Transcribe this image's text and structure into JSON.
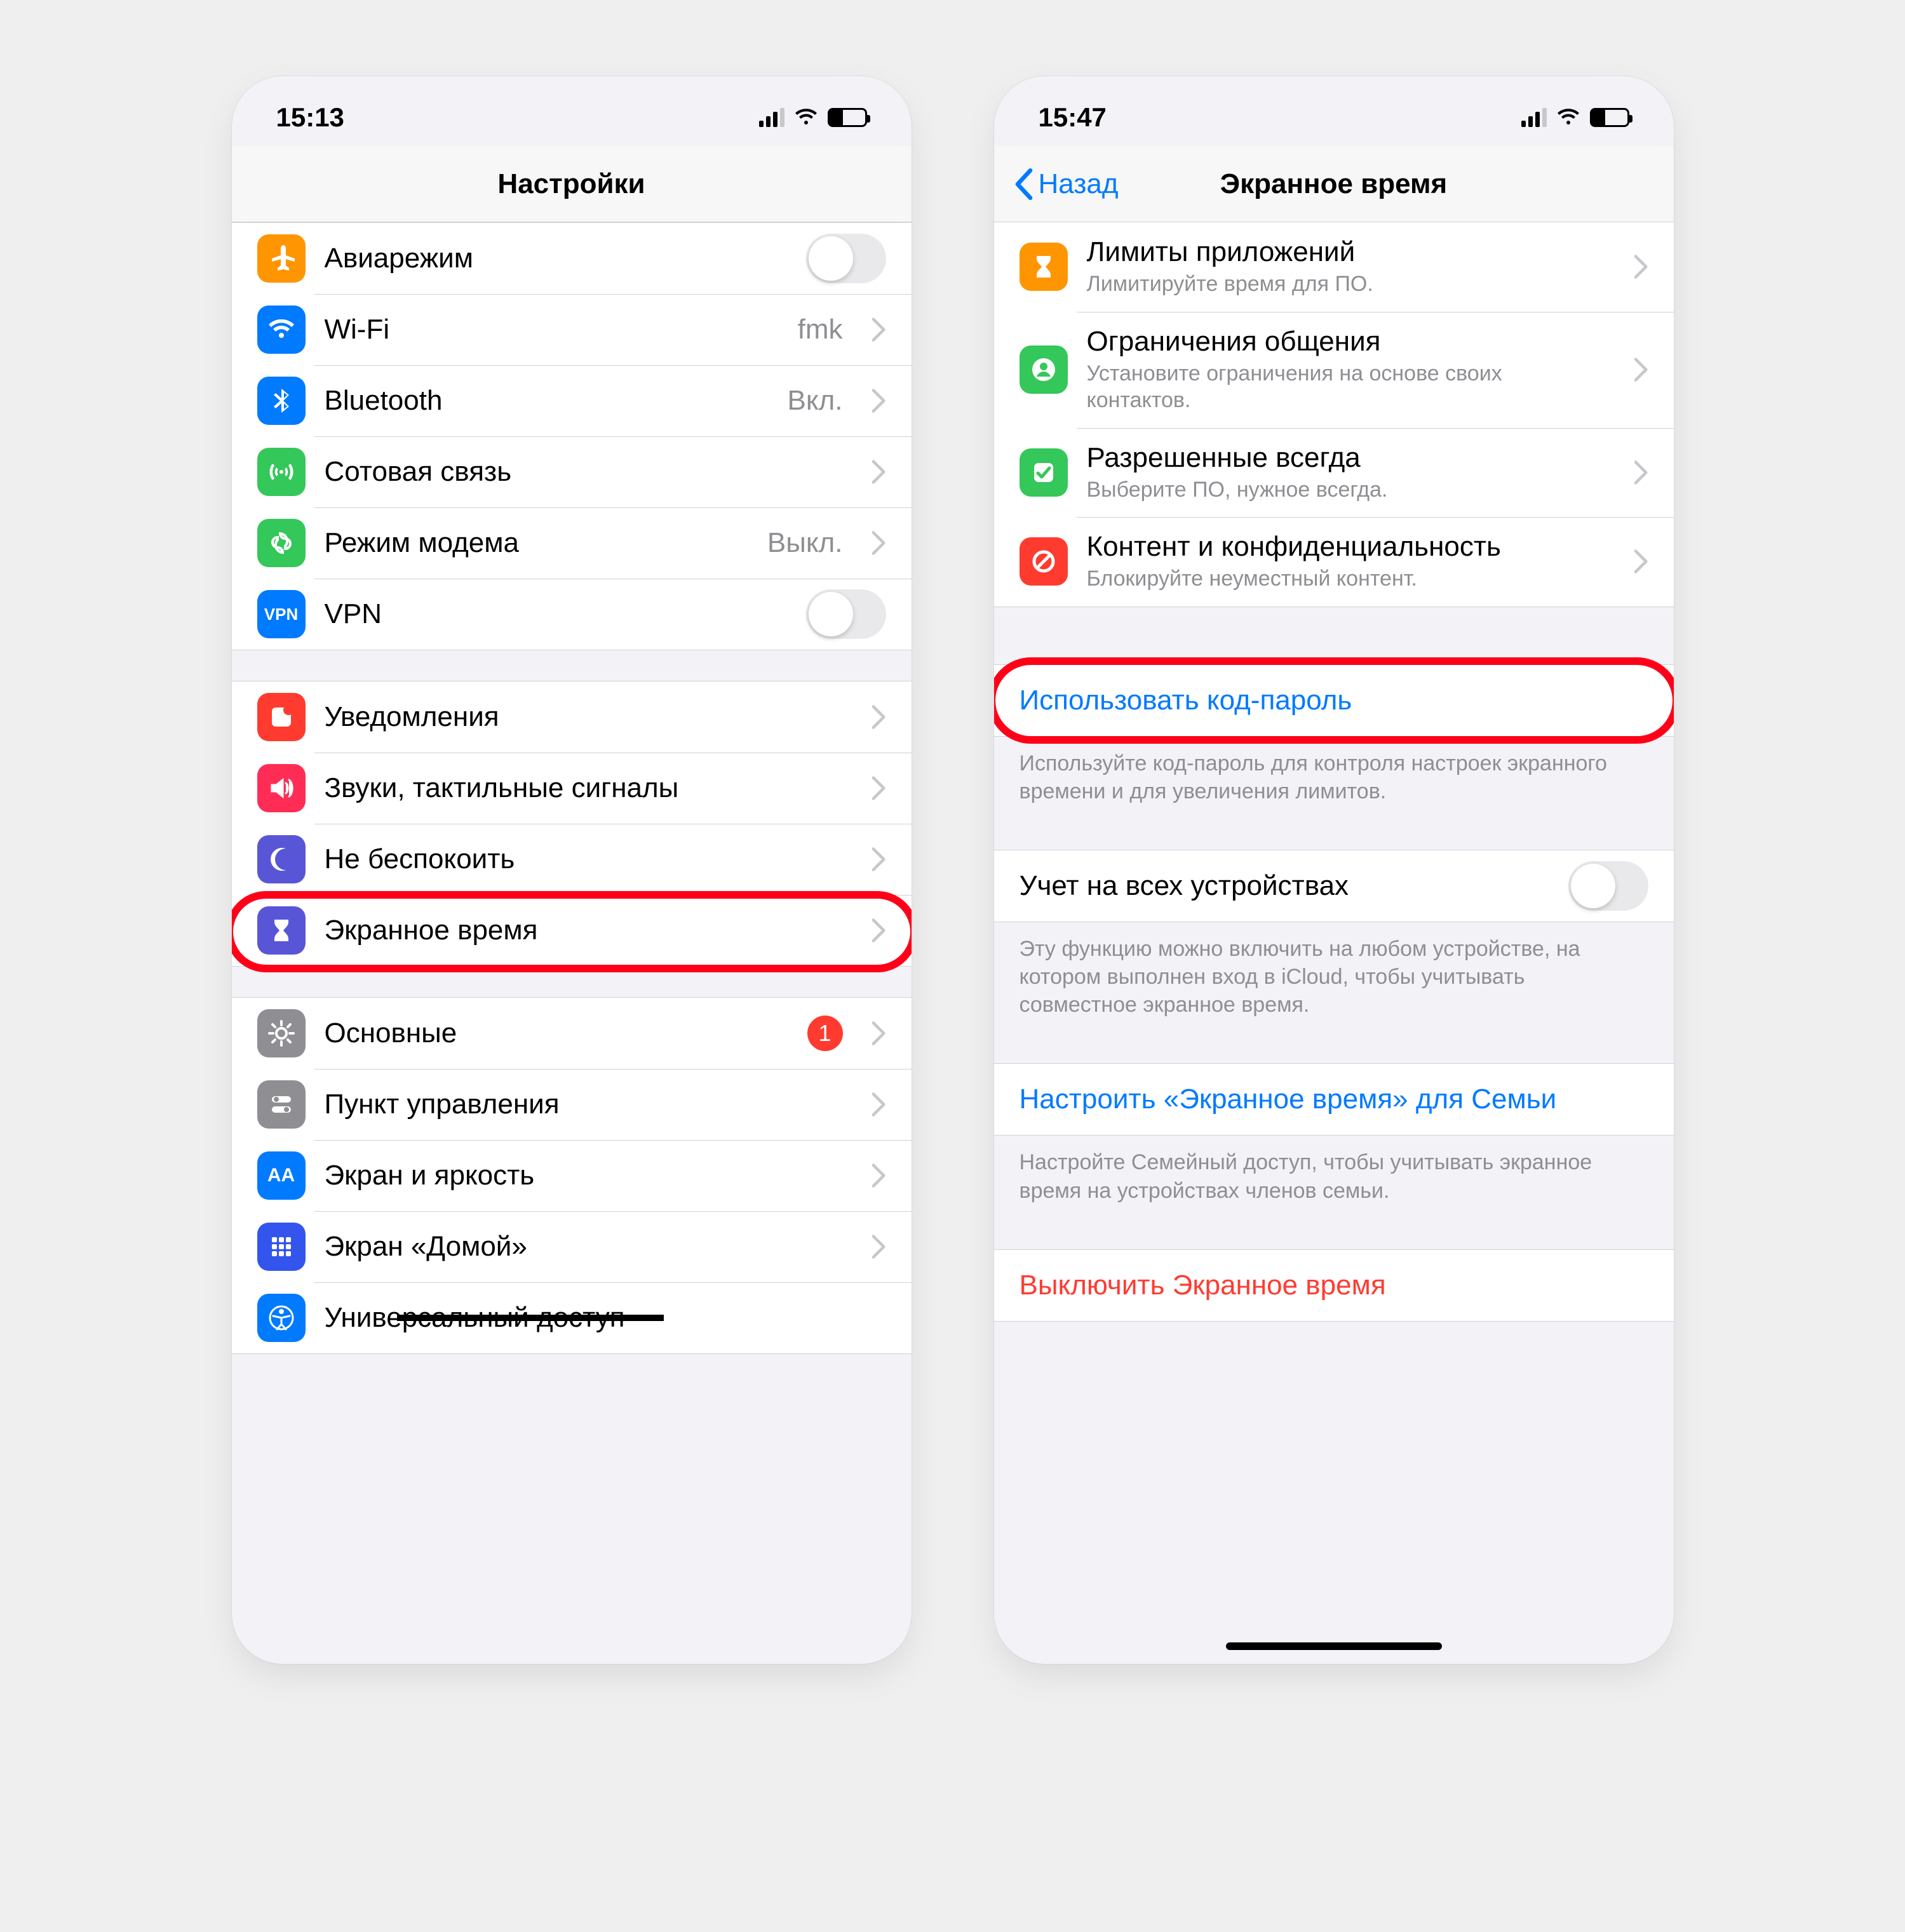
{
  "left": {
    "status_time": "15:13",
    "title": "Настройки",
    "g1": [
      {
        "icon": "airplane",
        "color": "#ff9500",
        "label": "Авиарежим",
        "toggle": true
      },
      {
        "icon": "wifi",
        "color": "#007aff",
        "label": "Wi-Fi",
        "value": "fmk",
        "chev": true
      },
      {
        "icon": "bluetooth",
        "color": "#007aff",
        "label": "Bluetooth",
        "value": "Вкл.",
        "chev": true
      },
      {
        "icon": "cellular",
        "color": "#34c759",
        "label": "Сотовая связь",
        "chev": true
      },
      {
        "icon": "hotspot",
        "color": "#34c759",
        "label": "Режим модема",
        "value": "Выкл.",
        "chev": true
      },
      {
        "icon": "vpn",
        "color": "#007aff",
        "label": "VPN",
        "toggle": true
      }
    ],
    "g2": [
      {
        "icon": "notifications",
        "color": "#ff3b30",
        "label": "Уведомления",
        "chev": true
      },
      {
        "icon": "sounds",
        "color": "#ff2d55",
        "label": "Звуки, тактильные сигналы",
        "chev": true
      },
      {
        "icon": "dnd",
        "color": "#5856d6",
        "label": "Не беспокоить",
        "chev": true
      },
      {
        "icon": "screentime",
        "color": "#5856d6",
        "label": "Экранное время",
        "chev": true,
        "highlight": true
      }
    ],
    "g3": [
      {
        "icon": "general",
        "color": "#8e8e93",
        "label": "Основные",
        "badge": "1",
        "chev": true
      },
      {
        "icon": "control",
        "color": "#8e8e93",
        "label": "Пункт управления",
        "chev": true
      },
      {
        "icon": "display",
        "color": "#007aff",
        "label": "Экран и яркость",
        "chev": true
      },
      {
        "icon": "home",
        "color": "#3355ee",
        "label": "Экран «Домой»",
        "chev": true
      },
      {
        "icon": "accessibility",
        "color": "#007aff",
        "label": "Универсальный доступ",
        "strike": true
      }
    ]
  },
  "right": {
    "status_time": "15:47",
    "back_label": "Назад",
    "title": "Экранное время",
    "g1": [
      {
        "icon": "hourglass",
        "color": "#ff9500",
        "label": "Лимиты приложений",
        "sub": "Лимитируйте время для ПО.",
        "chev": true
      },
      {
        "icon": "contact",
        "color": "#34c759",
        "label": "Ограничения общения",
        "sub": "Установите ограничения на основе своих контактов.",
        "chev": true
      },
      {
        "icon": "allowed",
        "color": "#34c759",
        "label": "Разрешенные всегда",
        "sub": "Выберите ПО, нужное всегда.",
        "chev": true
      },
      {
        "icon": "block",
        "color": "#ff3b30",
        "label": "Контент и конфиденциальность",
        "sub": "Блокируйте неуместный контент.",
        "chev": true
      }
    ],
    "passcode": {
      "label": "Использовать код-пароль",
      "footer": "Используйте код-пароль для контроля настроек экранного времени и для увеличения лимитов."
    },
    "share": {
      "label": "Учет на всех устройствах",
      "footer": "Эту функцию можно включить на любом устройстве, на котором выполнен вход в iCloud, чтобы учитывать совместное экранное время."
    },
    "family": {
      "label": "Настроить «Экранное время» для Семьи",
      "footer": "Настройте Семейный доступ, чтобы учитывать экранное время на устройствах членов семьи."
    },
    "turnoff": {
      "label": "Выключить Экранное время"
    }
  }
}
